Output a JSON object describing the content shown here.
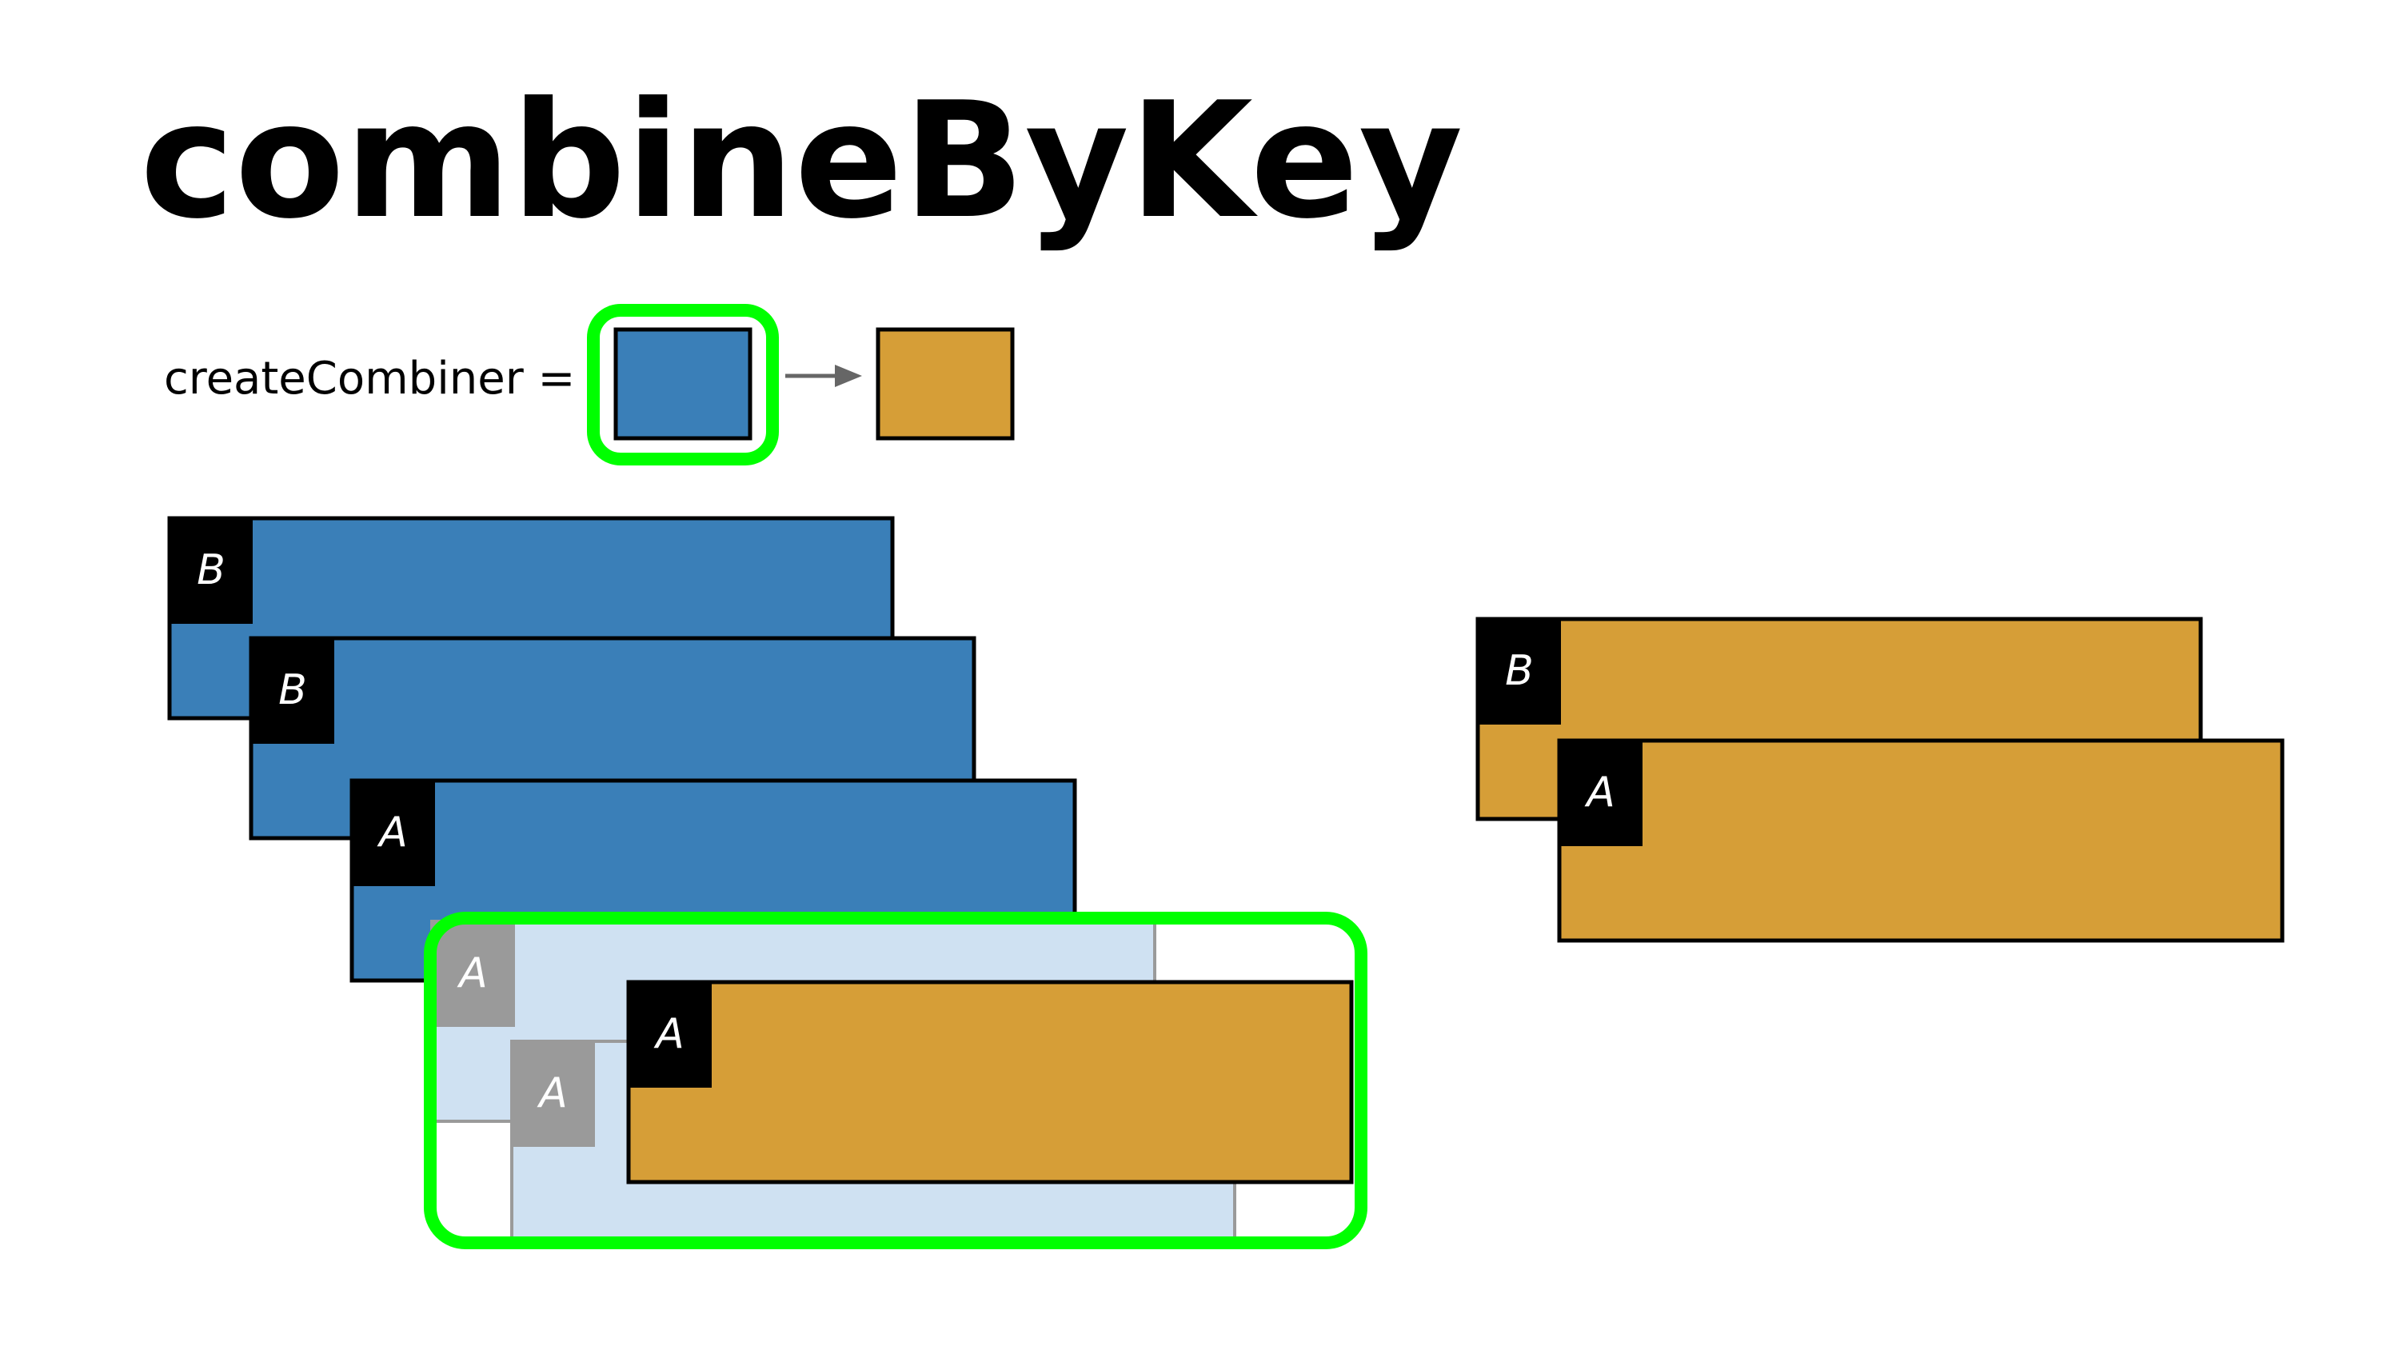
{
  "title": "combineByKey",
  "function_label": "createCombiner =",
  "colors": {
    "value": "#3a7fb8",
    "combiner": "#d69e37",
    "highlight": "#00ff00",
    "ghost_fill": "#cfe1f2",
    "ghost_key": "#9a9a9a",
    "key_bg": "#000000",
    "arrow": "#666666"
  },
  "input_records": [
    {
      "key": "B",
      "kind": "value"
    },
    {
      "key": "B",
      "kind": "value"
    },
    {
      "key": "A",
      "kind": "value"
    }
  ],
  "highlight_group": {
    "ghost_records": [
      {
        "key": "A"
      },
      {
        "key": "A"
      }
    ],
    "created_combiner": {
      "key": "A",
      "kind": "combiner"
    }
  },
  "output_records": [
    {
      "key": "B",
      "kind": "combiner"
    },
    {
      "key": "A",
      "kind": "combiner"
    }
  ],
  "legend": {
    "from": "value-box-icon",
    "to": "combiner-box-icon",
    "arrow": "arrow-right-icon"
  }
}
